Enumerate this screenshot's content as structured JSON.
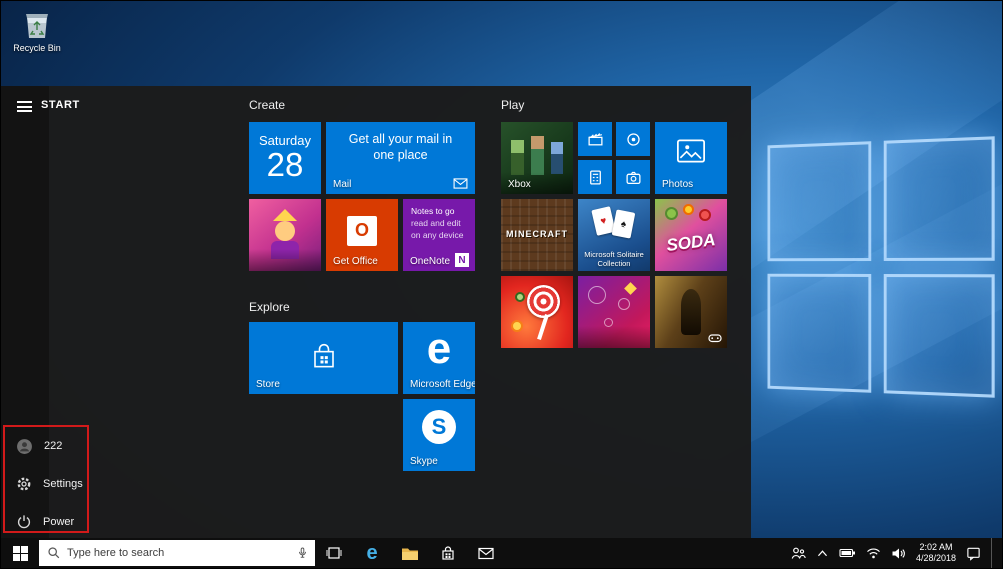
{
  "colors": {
    "accent_blue": "#0078d7",
    "office_orange": "#d83b01",
    "onenote_purple": "#7719aa",
    "annotation_red": "#d21a1a",
    "taskbar_black": "#0e0e0e"
  },
  "desktop": {
    "recycle_bin_label": "Recycle Bin"
  },
  "start": {
    "start_label": "START",
    "user_label": "222",
    "settings_label": "Settings",
    "power_label": "Power",
    "groups": {
      "create": "Create",
      "play": "Play",
      "explore": "Explore"
    },
    "tiles": {
      "calendar": {
        "weekday": "Saturday",
        "day": "28"
      },
      "mail": {
        "message": "Get all your mail in one place",
        "label": "Mail"
      },
      "get_office": {
        "label": "Get Office",
        "logo_letter": "O"
      },
      "onenote": {
        "line1": "Notes to go",
        "line2": "read and edit",
        "line3": "on any device",
        "label": "OneNote",
        "logo_letter": "N"
      },
      "xbox": {
        "label": "Xbox"
      },
      "photos": {
        "label": "Photos"
      },
      "minecraft": {
        "logo": "MINECRAFT"
      },
      "solitaire": {
        "label": "Microsoft Solitaire Collection",
        "card1_suit": "♥",
        "card2_suit": "♠"
      },
      "soda": {
        "logo": "SODA"
      },
      "store": {
        "label": "Store"
      },
      "edge": {
        "label": "Microsoft Edge",
        "logo_letter": "e"
      },
      "skype": {
        "label": "Skype",
        "logo_letter": "S"
      }
    }
  },
  "taskbar": {
    "search_placeholder": "Type here to search",
    "clock": {
      "time": "2:02 AM",
      "date": "4/28/2018"
    }
  }
}
